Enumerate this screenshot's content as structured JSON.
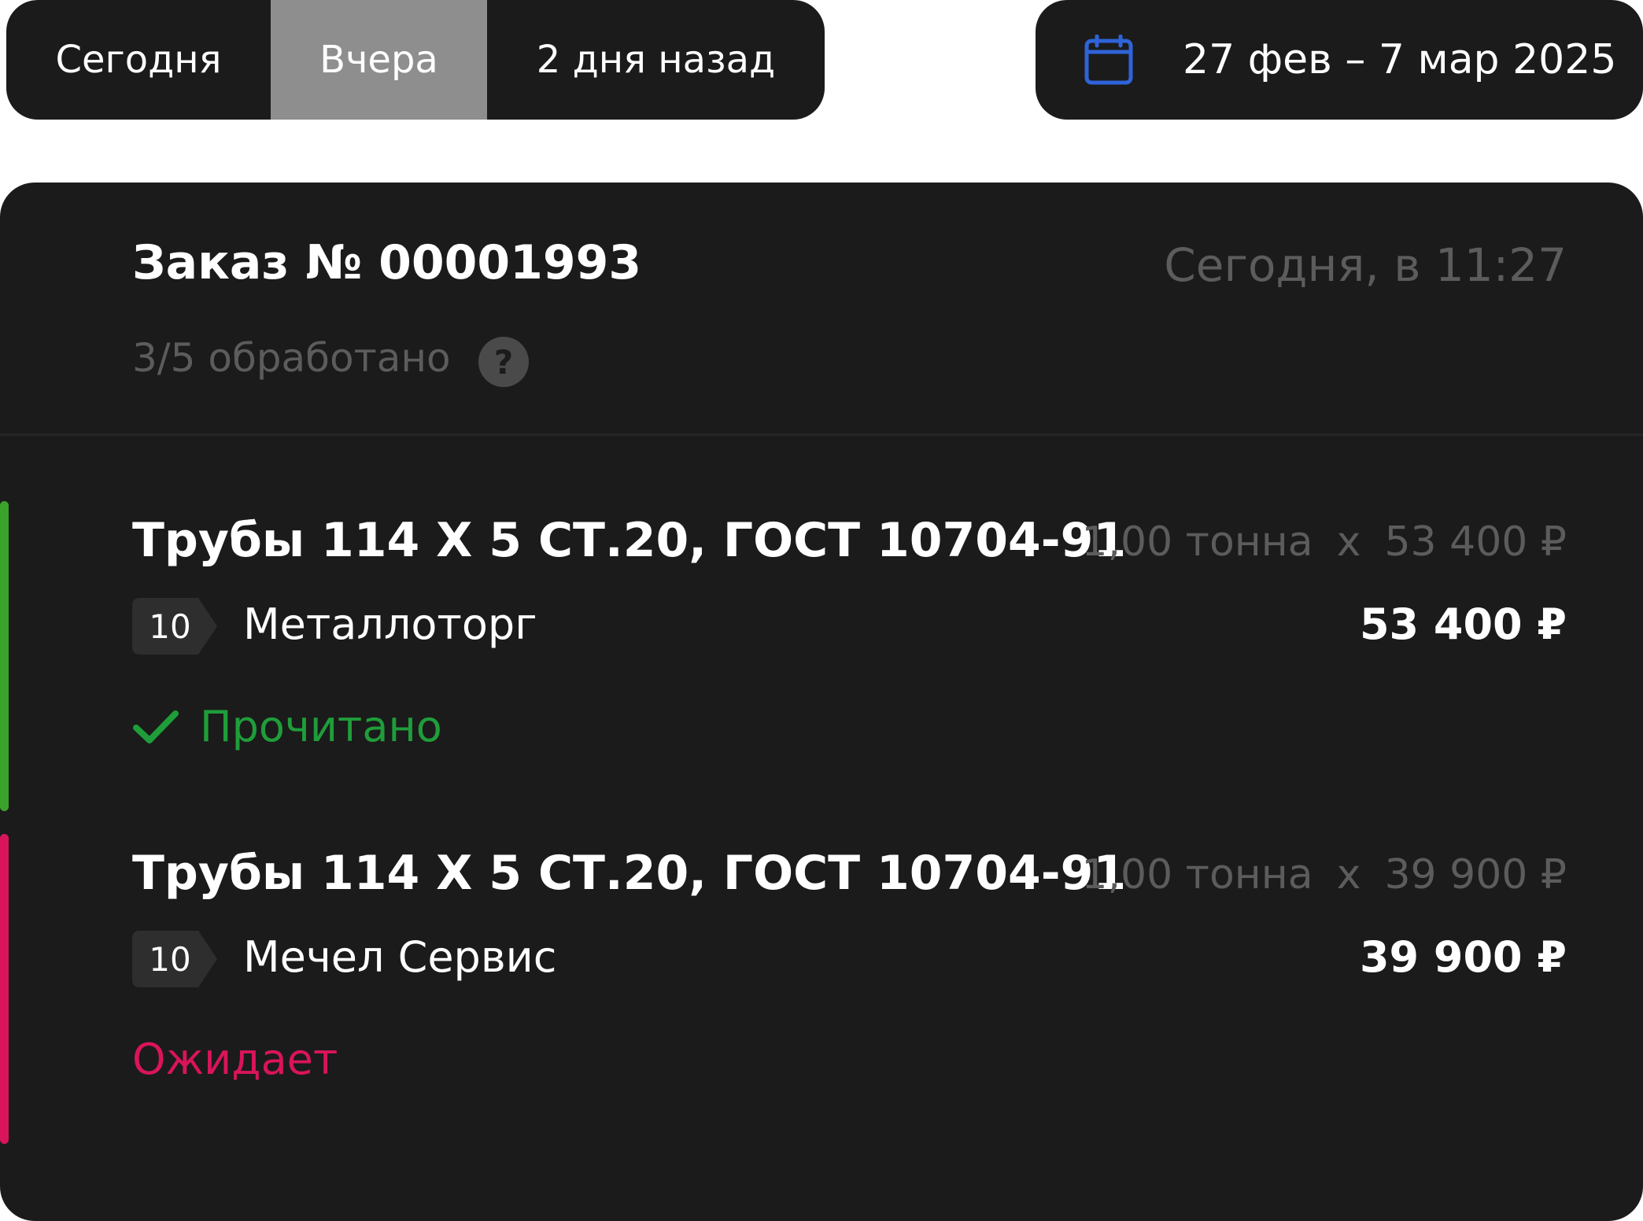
{
  "filters": {
    "today": "Сегодня",
    "yesterday": "Вчера",
    "two_days_ago": "2 дня назад",
    "selected": "Вчера"
  },
  "date_range": {
    "icon": "calendar-icon",
    "text": "27 фев – 7 мар 2025"
  },
  "order": {
    "title": "Заказ № 00001993",
    "time": "Сегодня, в 11:27",
    "processed": "3/5 обработано",
    "help_icon": "?",
    "items": [
      {
        "name": "Трубы 114 Х 5 СТ.20, ГОСТ 10704-91",
        "quantity": "1,00 тонна",
        "times": "x",
        "unit_price": "53 400 ₽",
        "rating": "10",
        "supplier": "Металлоторг",
        "total": "53 400 ₽",
        "status": "Прочитано",
        "status_color": "#1f9d3a",
        "bar_color": "#3aa329"
      },
      {
        "name": "Трубы 114 Х 5 СТ.20, ГОСТ 10704-91",
        "quantity": "1,00 тонна",
        "times": "x",
        "unit_price": "39 900 ₽",
        "rating": "10",
        "supplier": "Мечел Сервис",
        "total": "39 900 ₽",
        "status": "Ожидает",
        "status_color": "#d9145a",
        "bar_color": "#d9145a"
      }
    ]
  },
  "colors": {
    "background": "#ffffff",
    "panel": "#1b1b1b",
    "selected_segment": "#8e8e8e",
    "muted_text": "#5c5c5c",
    "calendar_icon": "#2f63d8"
  }
}
